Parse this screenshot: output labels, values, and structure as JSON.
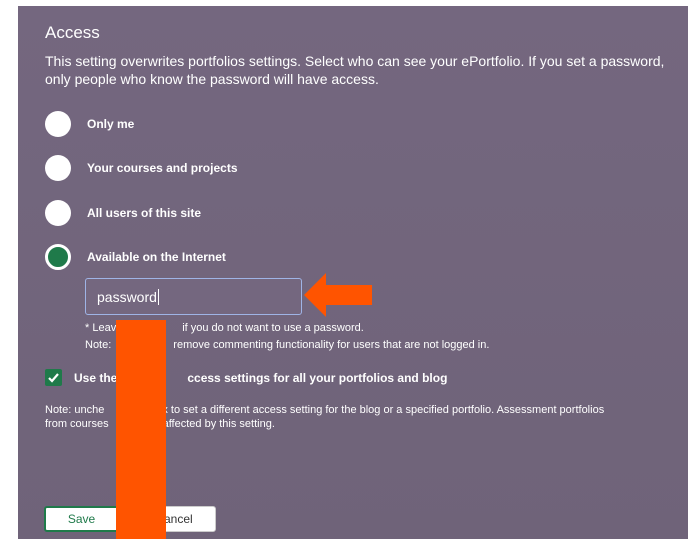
{
  "access": {
    "title": "Access",
    "description": "This setting overwrites portfolios settings. Select who can see your ePortfolio. If you set a password, only people who know the password will have access.",
    "options": [
      {
        "label": "Only me",
        "selected": false
      },
      {
        "label": "Your courses and projects",
        "selected": false
      },
      {
        "label": "All users of this site",
        "selected": false
      },
      {
        "label": "Available on the Internet",
        "selected": true
      }
    ],
    "password": {
      "value": "password"
    },
    "notes": {
      "line1_left": "* Leav",
      "line1_right": "if you do not want to use a password.",
      "line2_left": "Note:",
      "line2_right": "remove commenting functionality for users that are not logged in."
    },
    "checkbox": {
      "checked": true,
      "label_left": "Use the",
      "label_right": "ccess settings for all your portfolios and blog"
    },
    "bottom_note": {
      "line1_left": "Note: unche",
      "line1_right": "x to set a different access setting for the blog or a specified portfolio. Assessment portfolios",
      "line2_left": "from courses",
      "line2_right": "affected by this setting."
    },
    "buttons": {
      "save": "Save",
      "cancel": "Cancel"
    }
  },
  "colors": {
    "panel_bg": "#74677f",
    "selected_green": "#1f7a4a",
    "annotation_orange": "#ff5400",
    "input_border": "#9fb4e6"
  },
  "icons": {
    "checkbox": "check-icon",
    "annotation": "arrow-left-icon"
  }
}
